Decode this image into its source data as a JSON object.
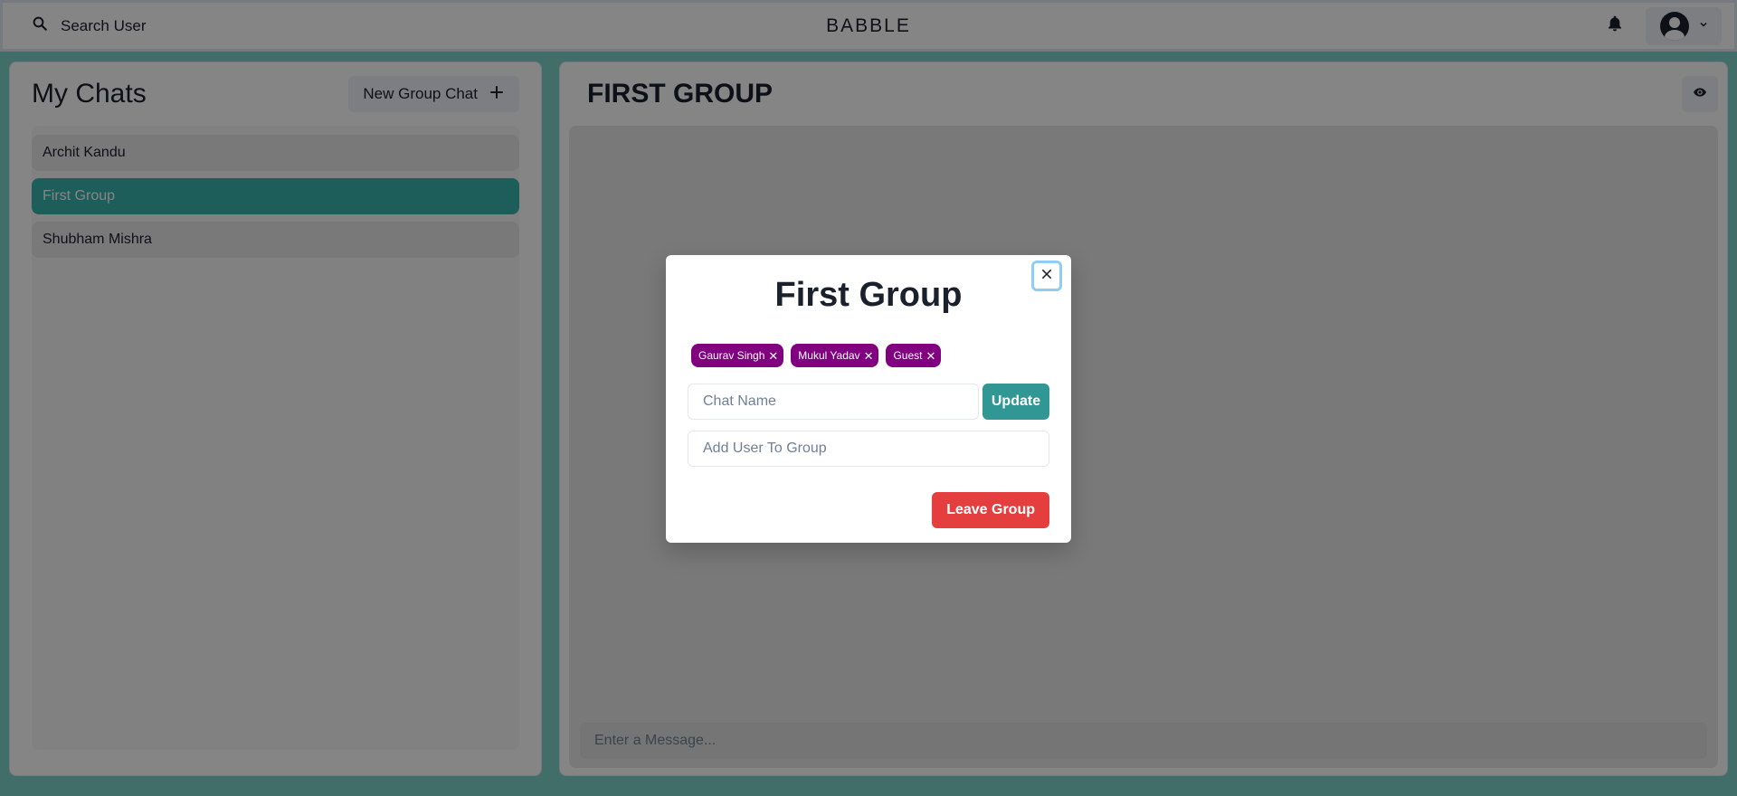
{
  "topbar": {
    "search_label": "Search User",
    "brand": "BABBLE",
    "icons": {
      "search": "search-icon",
      "bell": "bell-icon",
      "avatar": "user-avatar",
      "chevron": "chevron-down-icon"
    }
  },
  "chats": {
    "title": "My Chats",
    "new_group_label": "New Group Chat",
    "items": [
      {
        "label": "Archit Kandu",
        "selected": false
      },
      {
        "label": "First Group",
        "selected": true
      },
      {
        "label": "Shubham Mishra",
        "selected": false
      }
    ]
  },
  "chat_area": {
    "title": "FIRST GROUP",
    "message_placeholder": "Enter a Message..."
  },
  "modal": {
    "title": "First Group",
    "members": [
      {
        "name": "Gaurav Singh"
      },
      {
        "name": "Mukul Yadav"
      },
      {
        "name": "Guest"
      }
    ],
    "chat_name_placeholder": "Chat Name",
    "update_label": "Update",
    "add_user_placeholder": "Add User To Group",
    "leave_label": "Leave Group"
  },
  "colors": {
    "page_bg": "#7fd3cb",
    "selected_chat": "#38b2ac",
    "badge": "#800080",
    "update_button": "#319795",
    "leave_button": "#e53e3e"
  }
}
